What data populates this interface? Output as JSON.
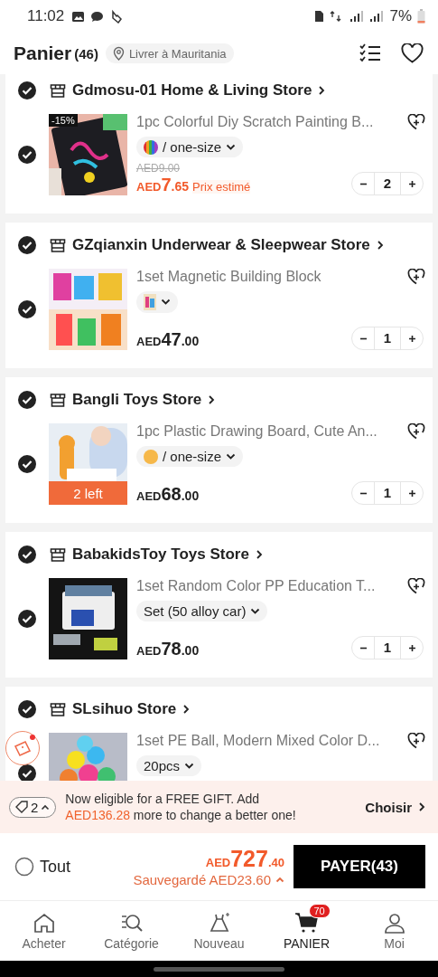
{
  "status_bar": {
    "time": "11:02",
    "battery": "7%"
  },
  "header": {
    "title": "Panier",
    "count": "(46)",
    "location": "Livrer à Mauritania"
  },
  "stores": [
    {
      "name": "Gdmosu-01 Home & Living Store",
      "checked": true,
      "items": [
        {
          "title": "1pc Colorful Diy Scratch Painting B...",
          "checked": true,
          "discount": "-15%",
          "variant": {
            "kind": "rainbow",
            "label": "/ one-size"
          },
          "old_price": "AED9.00",
          "sale": true,
          "price": {
            "currency": "AED",
            "whole": "7",
            "cents": ".65"
          },
          "price_note": "Prix estimé",
          "qty": "2"
        }
      ]
    },
    {
      "name": "GZqianxin Underwear & Sleepwear Store",
      "checked": true,
      "items": [
        {
          "title": "1set Magnetic Building Block",
          "checked": true,
          "variant": {
            "kind": "thumb"
          },
          "sale": false,
          "price": {
            "currency": "AED",
            "whole": "47",
            "cents": ".00"
          },
          "qty": "1"
        }
      ]
    },
    {
      "name": "Bangli Toys Store",
      "checked": true,
      "items": [
        {
          "title": "1pc Plastic Drawing Board, Cute An...",
          "checked": true,
          "stock_note": "2 left",
          "variant": {
            "kind": "dot",
            "color": "#f6b84a",
            "label": "/ one-size"
          },
          "sale": false,
          "price": {
            "currency": "AED",
            "whole": "68",
            "cents": ".00"
          },
          "qty": "1"
        }
      ]
    },
    {
      "name": "BabakidsToy Toys Store",
      "checked": true,
      "items": [
        {
          "title": "1set Random Color PP Education T...",
          "checked": true,
          "variant": {
            "kind": "text",
            "label": "Set (50 alloy car)"
          },
          "sale": false,
          "price": {
            "currency": "AED",
            "whole": "78",
            "cents": ".00"
          },
          "qty": "1"
        }
      ]
    },
    {
      "name": "SLsihuo Store",
      "checked": true,
      "items": [
        {
          "title": "1set PE Ball, Modern Mixed Color D...",
          "checked": true,
          "variant": {
            "kind": "text",
            "label": "20pcs"
          }
        }
      ]
    }
  ],
  "gift_banner": {
    "coupons": "2",
    "text_before": "Now eligible for a FREE GIFT. Add",
    "amount": "AED136.28",
    "text_after": "more to change a better one!",
    "action": "Choisir"
  },
  "checkout": {
    "select_all": {
      "label": "Tout",
      "checked": false
    },
    "total": {
      "currency": "AED",
      "whole": "727",
      "cents": ".40"
    },
    "savings": "Sauvegardé AED23.60",
    "button": "PAYER(43)"
  },
  "bottom_nav": [
    {
      "kind": "home",
      "label": "Acheter",
      "selected": false
    },
    {
      "kind": "category",
      "label": "Catégorie",
      "selected": false
    },
    {
      "kind": "dress",
      "label": "Nouveau",
      "selected": false
    },
    {
      "kind": "cart",
      "label": "PANIER",
      "selected": true,
      "badge": "70"
    },
    {
      "kind": "person",
      "label": "Moi",
      "selected": false
    }
  ]
}
